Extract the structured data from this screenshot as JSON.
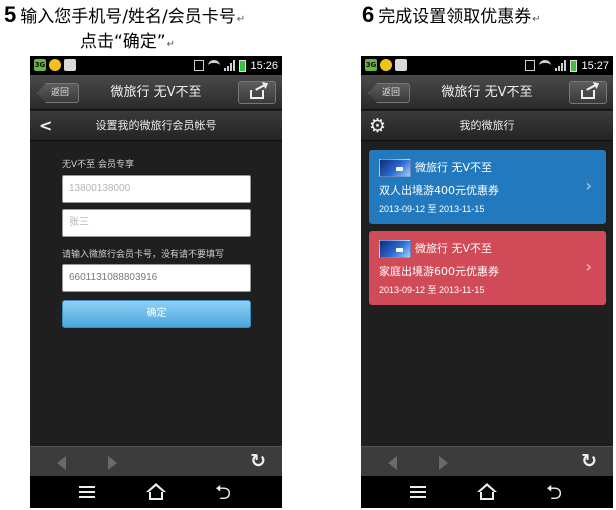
{
  "captions": {
    "step5_number": "5",
    "step5_text": "输入您手机号/姓名/会员卡号",
    "step5_text_line2": "点击“确定”",
    "step6_number": "6",
    "step6_text": "完成设置领取优惠券",
    "return_mark": "↵"
  },
  "screen1": {
    "status": {
      "time": "15:26"
    },
    "titlebar": {
      "back_label": "返回",
      "title": "微旅行 无V不至"
    },
    "subbar": {
      "title": "设置我的微旅行会员帐号"
    },
    "form": {
      "label_member": "无V不至 会员专享",
      "phone_placeholder": "13800138000",
      "name_placeholder": "张三",
      "card_hint": "请输入微旅行会员卡号，没有请不要填写",
      "card_value": "6601131088803916",
      "confirm_label": "确定"
    }
  },
  "screen2": {
    "status": {
      "time": "15:27"
    },
    "titlebar": {
      "back_label": "返回",
      "title": "微旅行 无V不至"
    },
    "subbar": {
      "title": "我的微旅行"
    },
    "coupons": [
      {
        "name": "微旅行 无V不至",
        "desc": "双人出境游400元优惠券",
        "dates": "2013-09-12 至 2013-11-15",
        "color": "#2379bd"
      },
      {
        "name": "微旅行 无V不至",
        "desc": "家庭出境游600元优惠券",
        "dates": "2013-09-12 至 2013-11-15",
        "color": "#d14a57"
      }
    ]
  },
  "colors": {
    "confirm_button": "#4aa6dd",
    "screen_bg": "#1f1f1f"
  },
  "icons": [
    "sim-icon",
    "notification-icon",
    "image-icon",
    "vibrate-icon",
    "wifi-icon",
    "signal-icon",
    "battery-icon",
    "share-icon",
    "chevron-left-icon",
    "gear-icon",
    "chevron-right-icon",
    "arrow-left-icon",
    "arrow-right-icon",
    "refresh-icon",
    "menu-icon",
    "home-icon",
    "back-icon"
  ]
}
